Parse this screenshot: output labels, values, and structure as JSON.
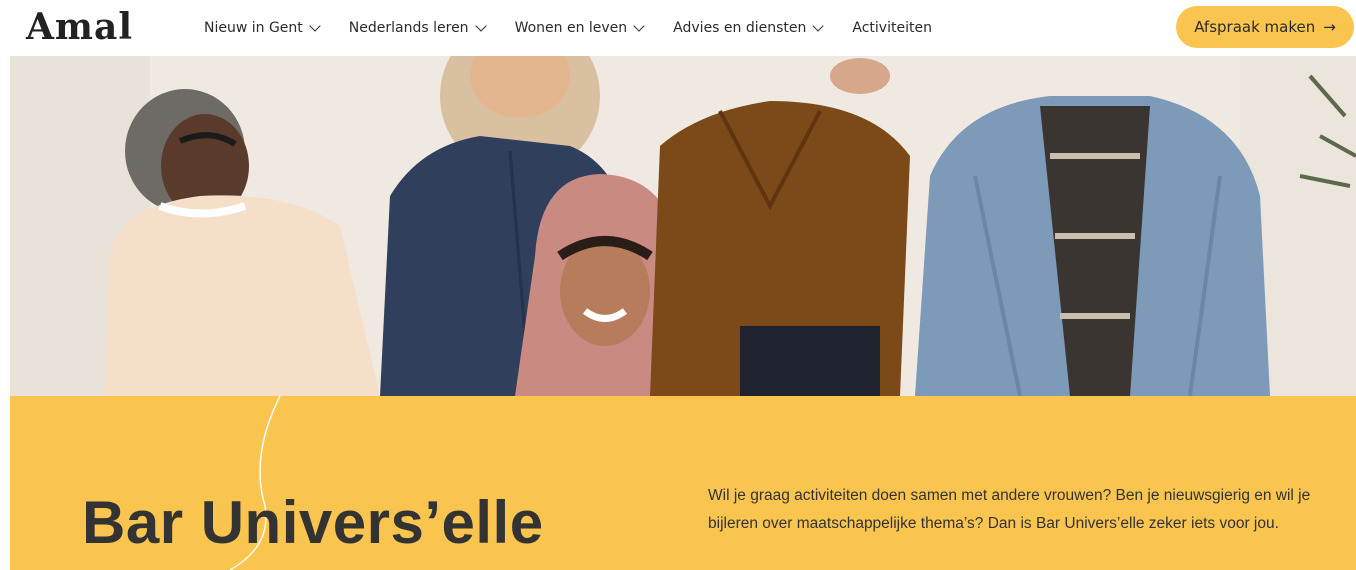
{
  "brand": {
    "logo_text": "Amal"
  },
  "nav": {
    "items": [
      {
        "label": "Nieuw in Gent",
        "has_dropdown": true
      },
      {
        "label": "Nederlands leren",
        "has_dropdown": true
      },
      {
        "label": "Wonen en leven",
        "has_dropdown": true
      },
      {
        "label": "Advies en diensten",
        "has_dropdown": true
      },
      {
        "label": "Activiteiten",
        "has_dropdown": false
      }
    ]
  },
  "cta": {
    "label": "Afspraak maken",
    "icon": "arrow-right-icon"
  },
  "colors": {
    "accent": "#f9c54f",
    "text": "#2b2b2b"
  },
  "intro": {
    "title": "Bar Univers’elle",
    "text": "Wil je graag activiteiten doen samen met andere vrouwen? Ben je nieuwsgierig en wil je bijleren over maatschappelijke thema’s? Dan is Bar Univers’elle zeker iets voor jou."
  }
}
